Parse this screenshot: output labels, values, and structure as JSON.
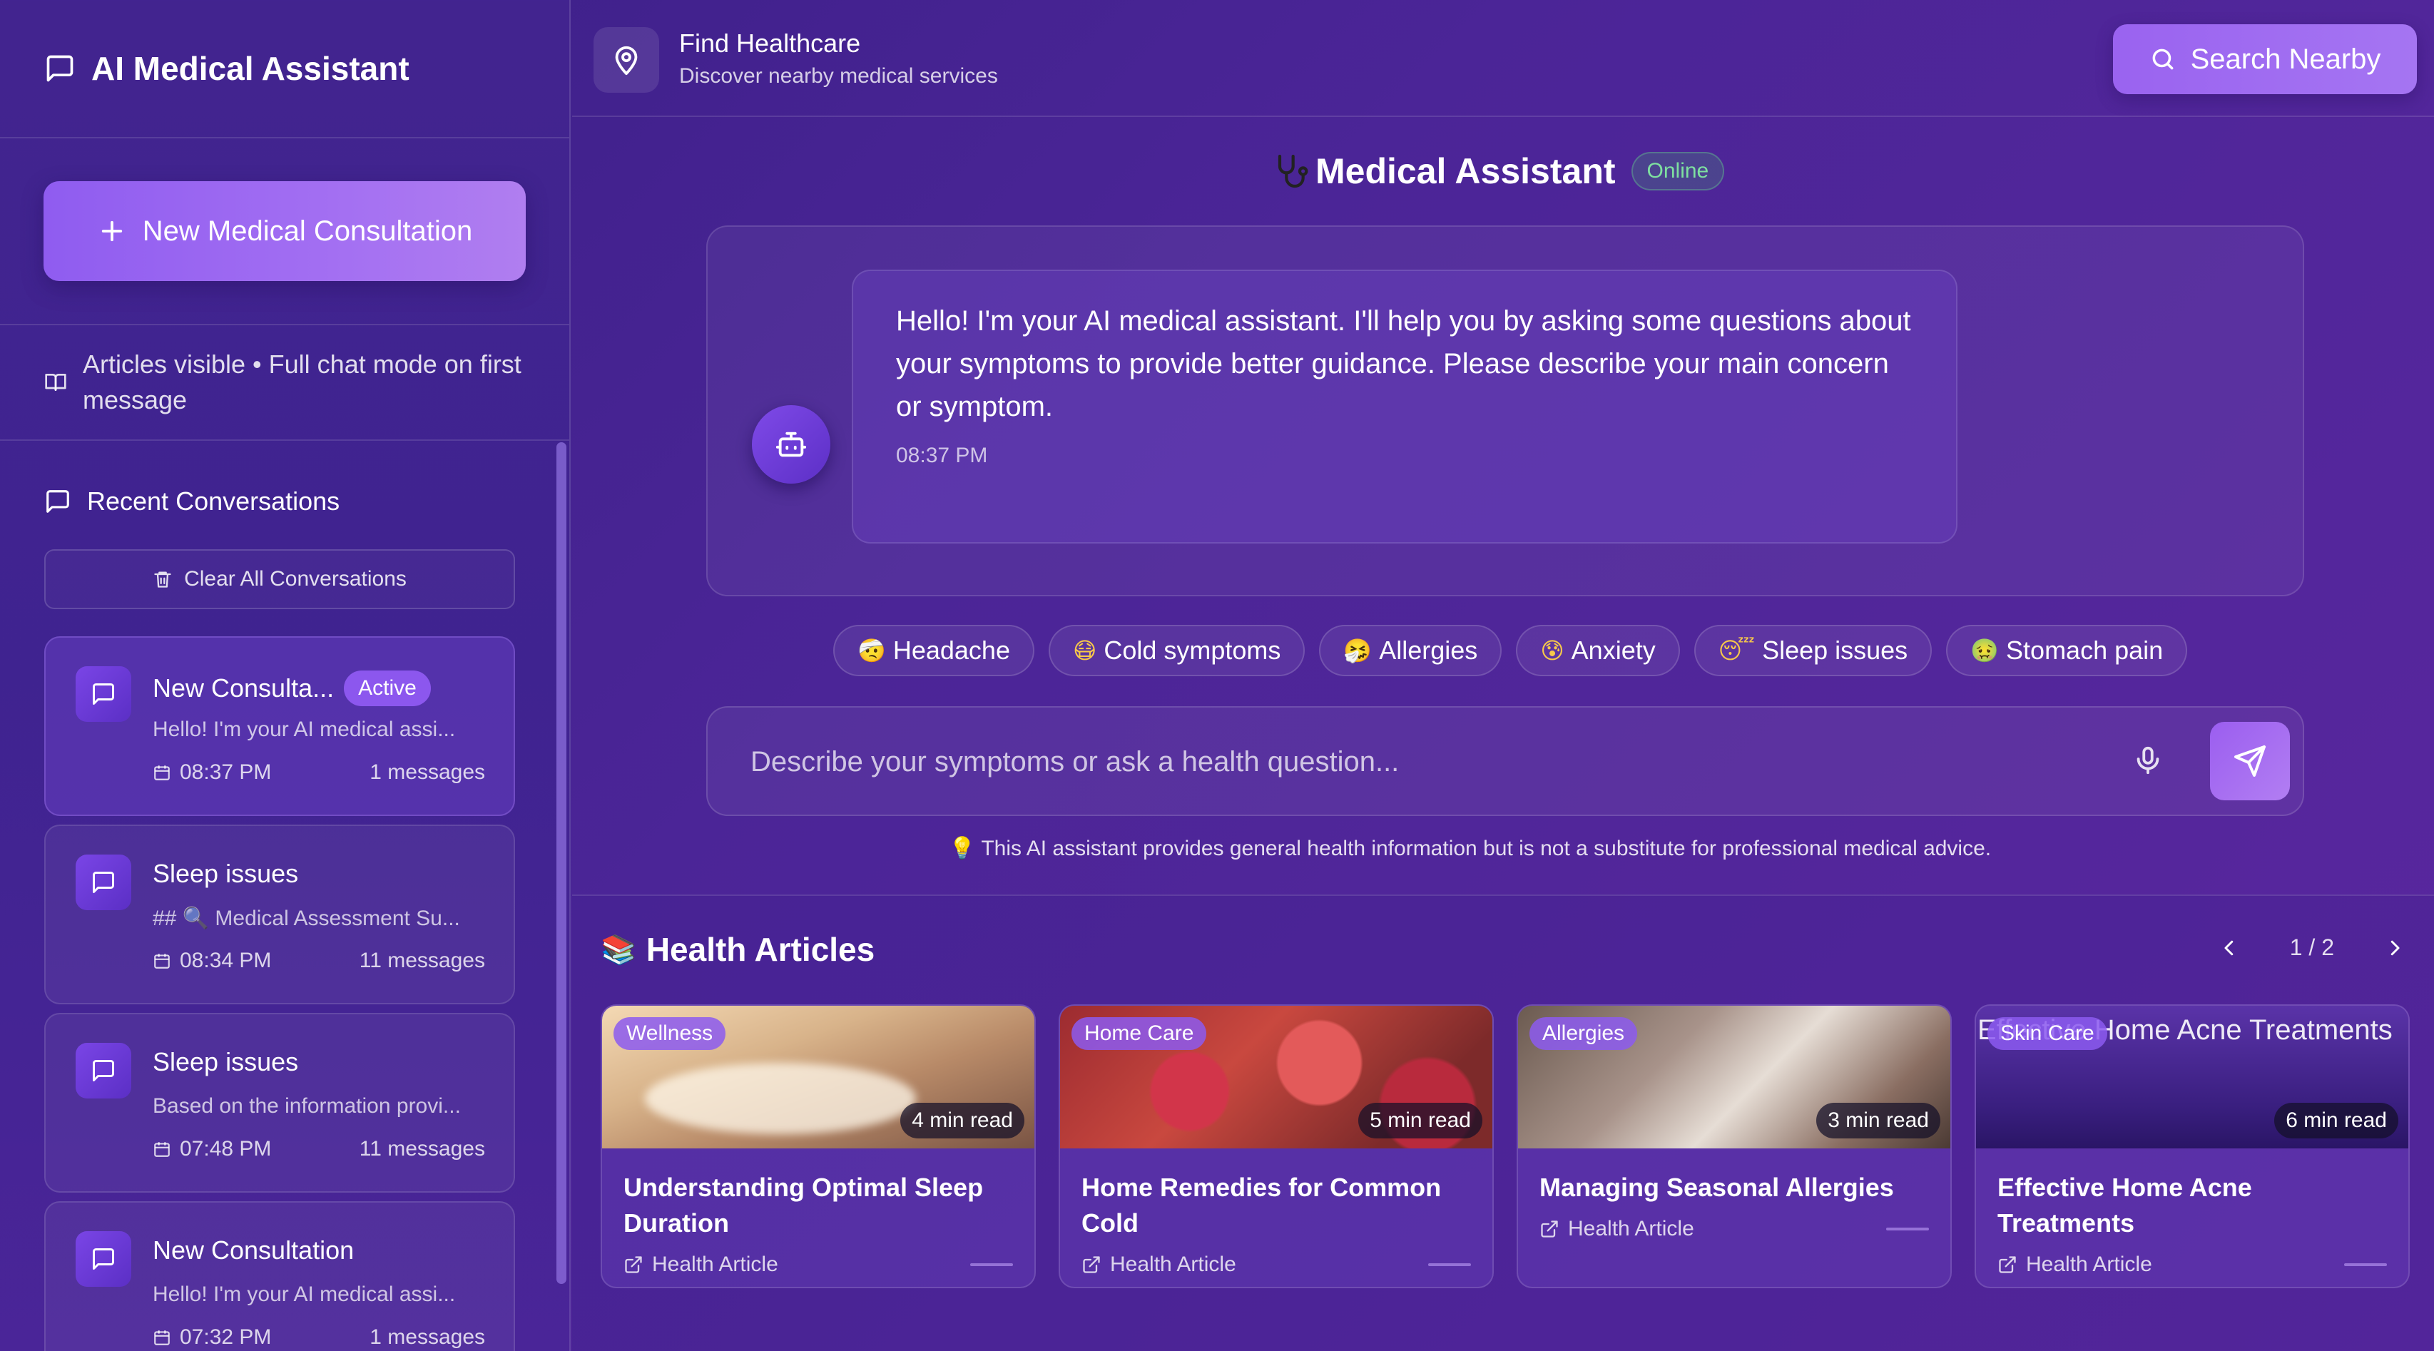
{
  "sidebar": {
    "title": "AI Medical Assistant",
    "new_button": "New Medical Consultation",
    "mode_text": "Articles visible • Full chat mode on first message",
    "recent_title": "Recent Conversations",
    "clear_button": "Clear All Conversations",
    "conversations": [
      {
        "title": "New Consulta...",
        "badge": "Active",
        "preview": "Hello! I'm your AI medical assi...",
        "time": "08:37 PM",
        "count": "1 messages"
      },
      {
        "title": "Sleep issues",
        "preview": "## 🔍 Medical Assessment Su...",
        "time": "08:34 PM",
        "count": "11 messages"
      },
      {
        "title": "Sleep issues",
        "preview": "Based on the information provi...",
        "time": "07:48 PM",
        "count": "11 messages"
      },
      {
        "title": "New Consultation",
        "preview": "Hello! I'm your AI medical assi...",
        "time": "07:32 PM",
        "count": "1 messages"
      }
    ]
  },
  "topbar": {
    "title": "Find Healthcare",
    "subtitle": "Discover nearby medical services",
    "search_button": "Search Nearby"
  },
  "chat": {
    "title": "Medical Assistant",
    "status": "Online",
    "message": "Hello! I'm your AI medical assistant. I'll help you by asking some questions about your symptoms to provide better guidance. Please describe your main concern or symptom.",
    "message_time": "08:37 PM",
    "chips": [
      {
        "emoji": "🤕",
        "label": "Headache"
      },
      {
        "emoji": "😷",
        "label": "Cold symptoms"
      },
      {
        "emoji": "🤧",
        "label": "Allergies"
      },
      {
        "emoji": "😰",
        "label": "Anxiety"
      },
      {
        "emoji": "😴",
        "label": "Sleep issues"
      },
      {
        "emoji": "🤢",
        "label": "Stomach pain"
      }
    ],
    "input_placeholder": "Describe your symptoms or ask a health question...",
    "disclaimer_icon": "💡",
    "disclaimer": "This AI assistant provides general health information but is not a substitute for professional medical advice."
  },
  "articles": {
    "icon": "📚",
    "title": "Health Articles",
    "page": "1 / 2",
    "cards": [
      {
        "tag": "Wellness",
        "read": "4 min read",
        "title": "Understanding Optimal Sleep Duration",
        "source": "Health Article"
      },
      {
        "tag": "Home Care",
        "read": "5 min read",
        "title": "Home Remedies for Common Cold",
        "source": "Health Article"
      },
      {
        "tag": "Allergies",
        "read": "3 min read",
        "title": "Managing Seasonal Allergies",
        "source": "Health Article"
      },
      {
        "tag": "Skin Care",
        "read": "6 min read",
        "title": "Effective Home Acne Treatments",
        "source": "Health Article",
        "img_alt": "Effective Home Acne Treatments"
      }
    ]
  },
  "colors": {
    "accent": "#9a63f0",
    "background": "#4b2597",
    "online": "#7ee0a0"
  }
}
